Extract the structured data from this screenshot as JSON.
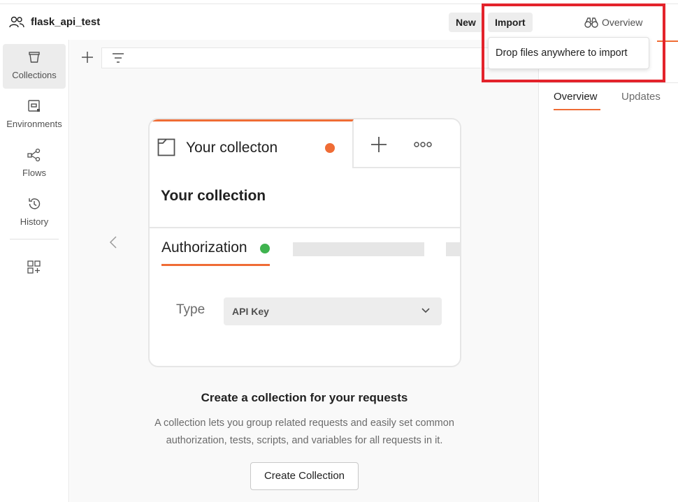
{
  "header": {
    "workspace_icon": "people-icon",
    "workspace_title": "flask_api_test",
    "new_label": "New",
    "import_label": "Import"
  },
  "sidebar": {
    "items": [
      {
        "label": "Collections",
        "icon": "trash-bin-icon",
        "active": true
      },
      {
        "label": "Environments",
        "icon": "environment-icon",
        "active": false
      },
      {
        "label": "Flows",
        "icon": "flows-icon",
        "active": false
      },
      {
        "label": "History",
        "icon": "history-icon",
        "active": false
      }
    ],
    "more_icon": "add-widgets-icon"
  },
  "illustration": {
    "tab_title": "Your collecton",
    "heading": "Your collection",
    "auth_tab": "Authorization",
    "type_label": "Type",
    "type_value": "API Key"
  },
  "empty_state": {
    "title": "Create a collection for your requests",
    "description": "A collection lets you group related requests and easily set common authorization, tests, scripts, and variables for all requests in it.",
    "button_label": "Create Collection"
  },
  "right_panel": {
    "overview_label": "Overview",
    "tabs": [
      "Overview",
      "Updates"
    ]
  },
  "tooltip": {
    "text": "Drop files anywhere to import"
  },
  "colors": {
    "accent": "#ef6c35",
    "success": "#3fb34f",
    "highlight": "#e3232b"
  }
}
